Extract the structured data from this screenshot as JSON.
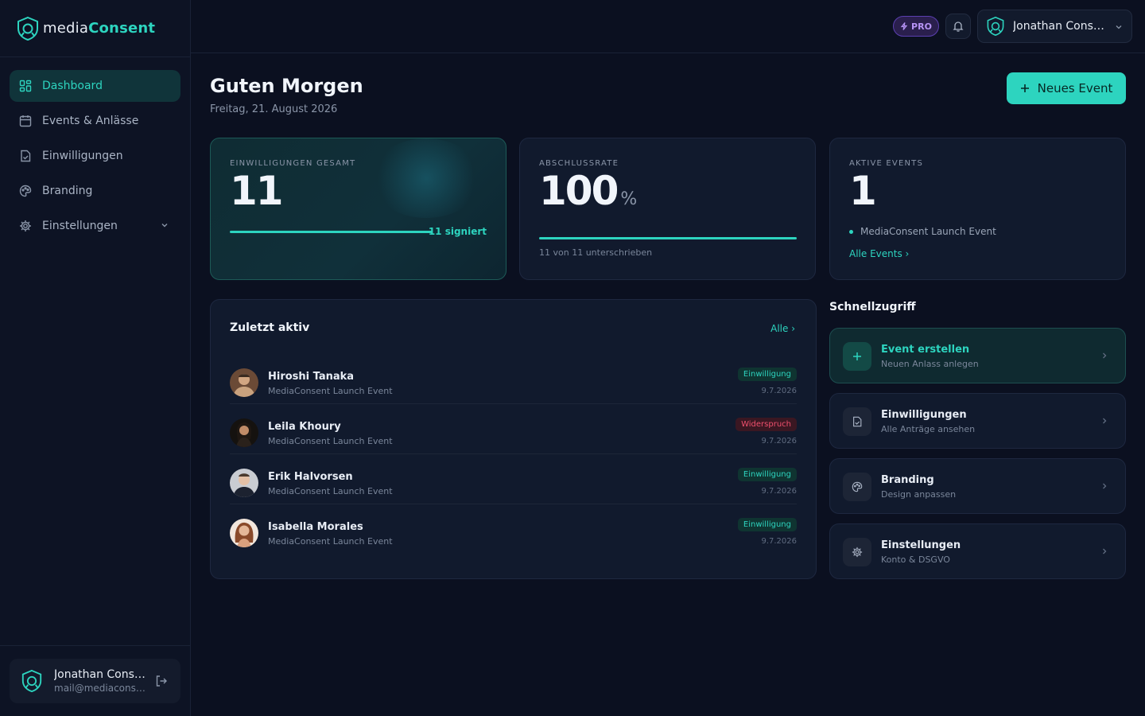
{
  "brand": {
    "name_part1": "media",
    "name_part2": "Consent"
  },
  "sidebar": {
    "items": [
      {
        "label": "Dashboard",
        "icon": "dashboard-grid-icon",
        "active": true
      },
      {
        "label": "Events & Anlässe",
        "icon": "calendar-icon"
      },
      {
        "label": "Einwilligungen",
        "icon": "document-check-icon"
      },
      {
        "label": "Branding",
        "icon": "palette-icon"
      },
      {
        "label": "Einstellungen",
        "icon": "gear-icon"
      }
    ],
    "user": {
      "name": "Jonathan Consent",
      "email": "mail@mediaconsent.de"
    }
  },
  "topbar": {
    "badge": "PRO",
    "account_name": "Jonathan Consent"
  },
  "header": {
    "greeting": "Guten Morgen",
    "date": "Freitag, 21. August 2026",
    "new_event_label": "Neues Event"
  },
  "stats": {
    "consents": {
      "label": "EINWILLIGUNGEN GESAMT",
      "value": "11",
      "signed": "11 signiert",
      "progress": 1.0
    },
    "completion": {
      "label": "ABSCHLUSSRATE",
      "value": "100",
      "unit": "%",
      "detail": "11 von 11 unterschrieben",
      "progress": 1.0
    },
    "active": {
      "label": "AKTIVE EVENTS",
      "value": "1",
      "event": "MediaConsent Launch Event",
      "link": "Alle Events"
    }
  },
  "recent": {
    "title": "Zuletzt aktiv",
    "all_label": "Alle",
    "rows": [
      {
        "name": "Hiroshi Tanaka",
        "event": "MediaConsent Launch Event",
        "status": "Einwilligung",
        "status_type": "ok",
        "date": "9.7.2026"
      },
      {
        "name": "Leila Khoury",
        "event": "MediaConsent Launch Event",
        "status": "Widerspruch",
        "status_type": "no",
        "date": "9.7.2026"
      },
      {
        "name": "Erik Halvorsen",
        "event": "MediaConsent Launch Event",
        "status": "Einwilligung",
        "status_type": "ok",
        "date": "9.7.2026"
      },
      {
        "name": "Isabella Morales",
        "event": "MediaConsent Launch Event",
        "status": "Einwilligung",
        "status_type": "ok",
        "date": "9.7.2026"
      }
    ]
  },
  "quick": {
    "title": "Schnellzugriff",
    "items": [
      {
        "title": "Event erstellen",
        "subtitle": "Neuen Anlass anlegen",
        "icon": "plus-icon"
      },
      {
        "title": "Einwilligungen",
        "subtitle": "Alle Anträge ansehen",
        "icon": "document-check-icon"
      },
      {
        "title": "Branding",
        "subtitle": "Design anpassen",
        "icon": "palette-icon"
      },
      {
        "title": "Einstellungen",
        "subtitle": "Konto & DSGVO",
        "icon": "gear-icon"
      }
    ]
  },
  "colors": {
    "accent": "#2dd4bf",
    "background": "#0b1020",
    "card": "#111a2d",
    "danger": "#f0506e",
    "pro": "#b794f6"
  }
}
